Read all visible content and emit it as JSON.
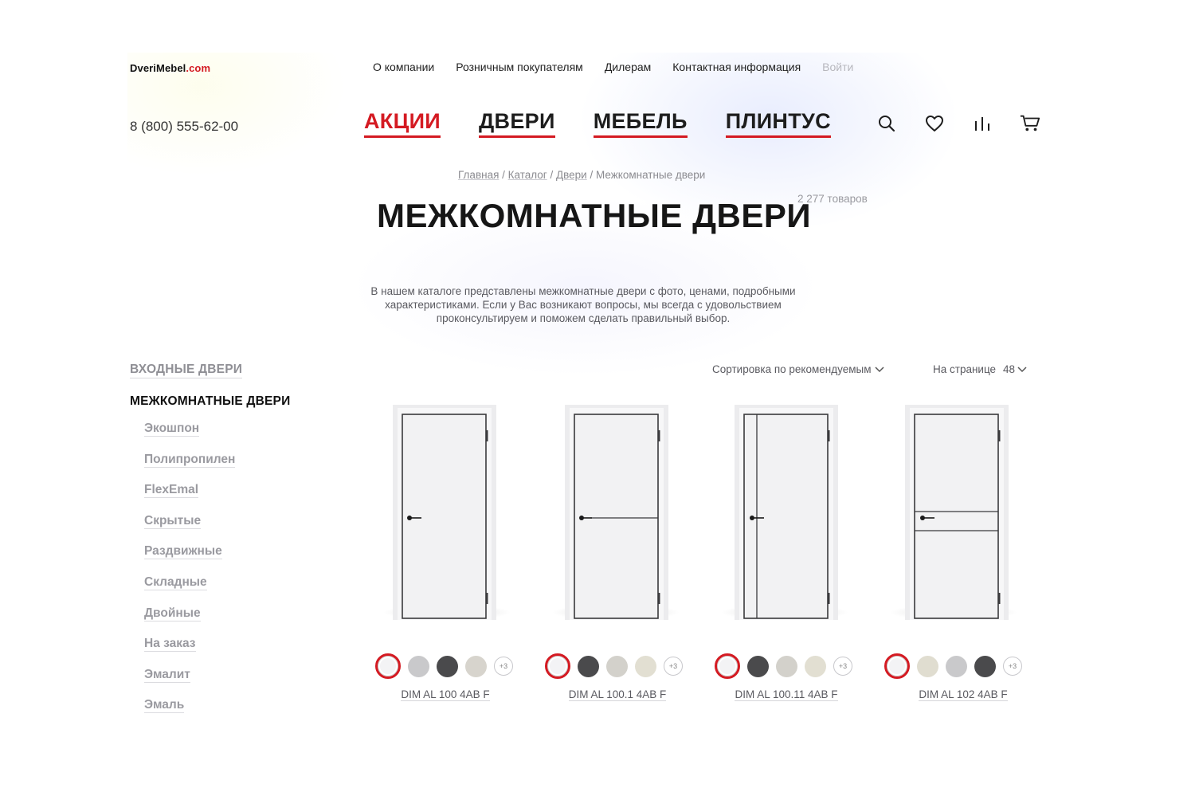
{
  "header": {
    "logo_main": "DveriMebel",
    "logo_domain": ".com",
    "top_links": [
      "О компании",
      "Розничным покупателям",
      "Дилерам",
      "Контактная информация"
    ],
    "login_label": "Войти",
    "phone": "8 (800) 555-62-00",
    "main_nav": [
      "АКЦИИ",
      "ДВЕРИ",
      "МЕБЕЛЬ",
      "ПЛИНТУС"
    ],
    "icons": [
      "search-icon",
      "heart-icon",
      "compare-icon",
      "cart-icon"
    ]
  },
  "breadcrumb": {
    "items": [
      "Главная",
      "Каталог",
      "Двери"
    ],
    "current": "Межкомнатные двери",
    "separator": " / "
  },
  "page": {
    "title": "МЕЖКОМНАТНЫЕ ДВЕРИ",
    "count": "2 277 товаров",
    "intro": "В нашем каталоге представлены межкомнатные двери с фото, ценами, подробными характеристиками. Если у Вас возникают вопросы, мы всегда с удовольствием проконсультируем и поможем сделать правильный выбор."
  },
  "sidebar": {
    "section_1": "ВХОДНЫЕ ДВЕРИ",
    "section_2": "МЕЖКОМНАТНЫЕ ДВЕРИ",
    "subitems": [
      "Экошпон",
      "Полипропилен",
      "FlexEmal",
      "Скрытые",
      "Раздвижные",
      "Складные",
      "Двойные",
      "На заказ",
      "Эмалит",
      "Эмаль"
    ]
  },
  "toolbar": {
    "sort_label": "Сортировка по рекомендуемым",
    "per_page_label": "На странице",
    "per_page_value": "48"
  },
  "products": [
    {
      "name": "DIM AL 100 4AB F",
      "variant": "plain",
      "swatches": [
        "#f3f3f5",
        "#c9c9cb",
        "#4a4a4c",
        "#d7d4cd"
      ],
      "more": "+3"
    },
    {
      "name": "DIM AL 100.1 4AB F",
      "variant": "horizontal-line",
      "swatches": [
        "#f3f3f5",
        "#4a4a4c",
        "#d3d1cb",
        "#e2dfd2"
      ],
      "more": "+3"
    },
    {
      "name": "DIM AL 100.11 4AB F",
      "variant": "vertical-line",
      "swatches": [
        "#f3f3f5",
        "#4a4a4c",
        "#d3d1cb",
        "#e2dfd2"
      ],
      "more": "+3"
    },
    {
      "name": "DIM AL 102 4AB F",
      "variant": "double-line",
      "swatches": [
        "#f3f3f5",
        "#e0ddd0",
        "#c9c9cb",
        "#4a4a4c"
      ],
      "more": "+3"
    }
  ],
  "colors": {
    "accent": "#d41a22",
    "text": "#1d1d1d",
    "muted": "#8f8f95"
  }
}
